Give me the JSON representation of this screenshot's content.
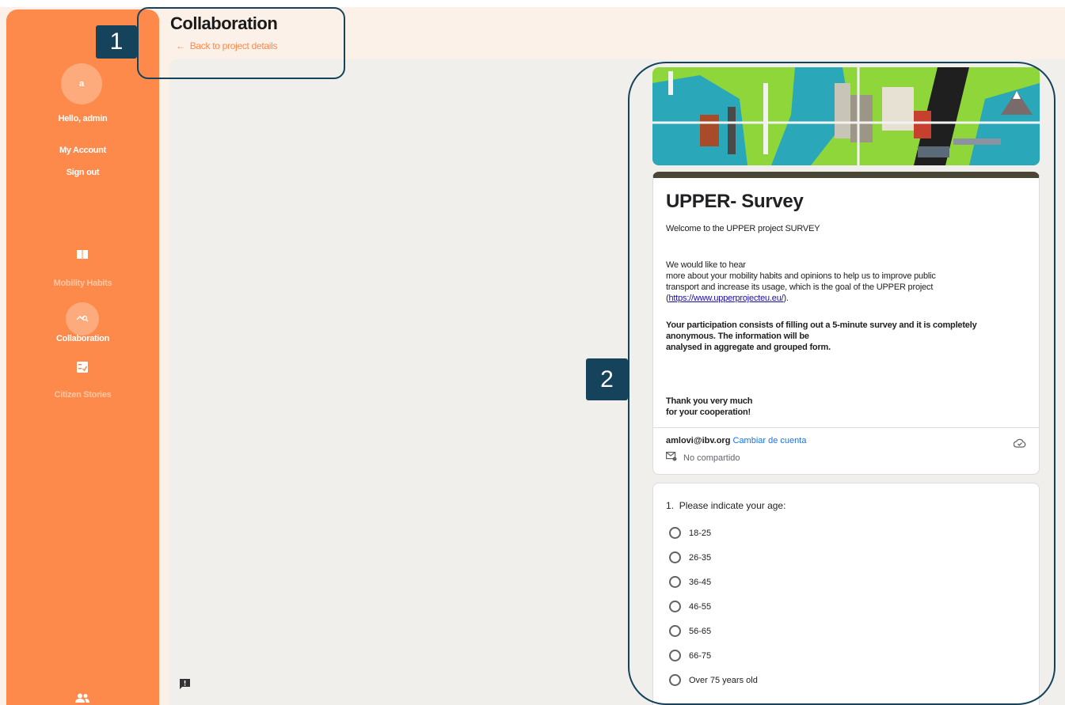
{
  "sidebar": {
    "avatar_initial": "a",
    "greeting": "Hello, admin",
    "my_account": "My Account",
    "sign_out": "Sign out",
    "nav": [
      {
        "label": "Mobility Habits",
        "icon": "book-icon",
        "active": false
      },
      {
        "label": "Collaboration",
        "icon": "chart-search-icon",
        "active": true
      },
      {
        "label": "Citizen Stories",
        "icon": "checklist-icon",
        "active": false
      }
    ],
    "bottom_icon": "users-icon"
  },
  "header": {
    "title": "Collaboration",
    "back_link": "Back to project details"
  },
  "callouts": {
    "one": "1",
    "two": "2"
  },
  "form": {
    "title": "UPPER- Survey",
    "welcome": "Welcome to the UPPER project SURVEY",
    "intro_line1": "We would like to hear",
    "intro_line2": "more about your mobility habits and opinions to help us to improve public",
    "intro_line3": "transport and increase its usage, which is the goal of the UPPER project",
    "intro_link": "https://www.upperprojecteu.eu/",
    "bold_line1": "Your participation consists of filling out a 5-minute survey and it is completely",
    "bold_line2": "anonymous. The information will be",
    "bold_line3": "analysed in aggregate and grouped form.",
    "thanks_line1": "Thank you very much",
    "thanks_line2": "for your cooperation!",
    "account_email": "amlovi@ibv.org",
    "switch_account": "Cambiar de cuenta",
    "not_shared": "No compartido",
    "question": {
      "number": "1.",
      "text": "Please indicate your age:",
      "options": [
        "18-25",
        "26-35",
        "36-45",
        "46-55",
        "56-65",
        "66-75",
        "Over 75 years old"
      ]
    }
  },
  "colors": {
    "sidebar": "#fd8a4b",
    "callout": "#16435c",
    "form_accent": "#4a4636",
    "link": "#1a73e8"
  }
}
